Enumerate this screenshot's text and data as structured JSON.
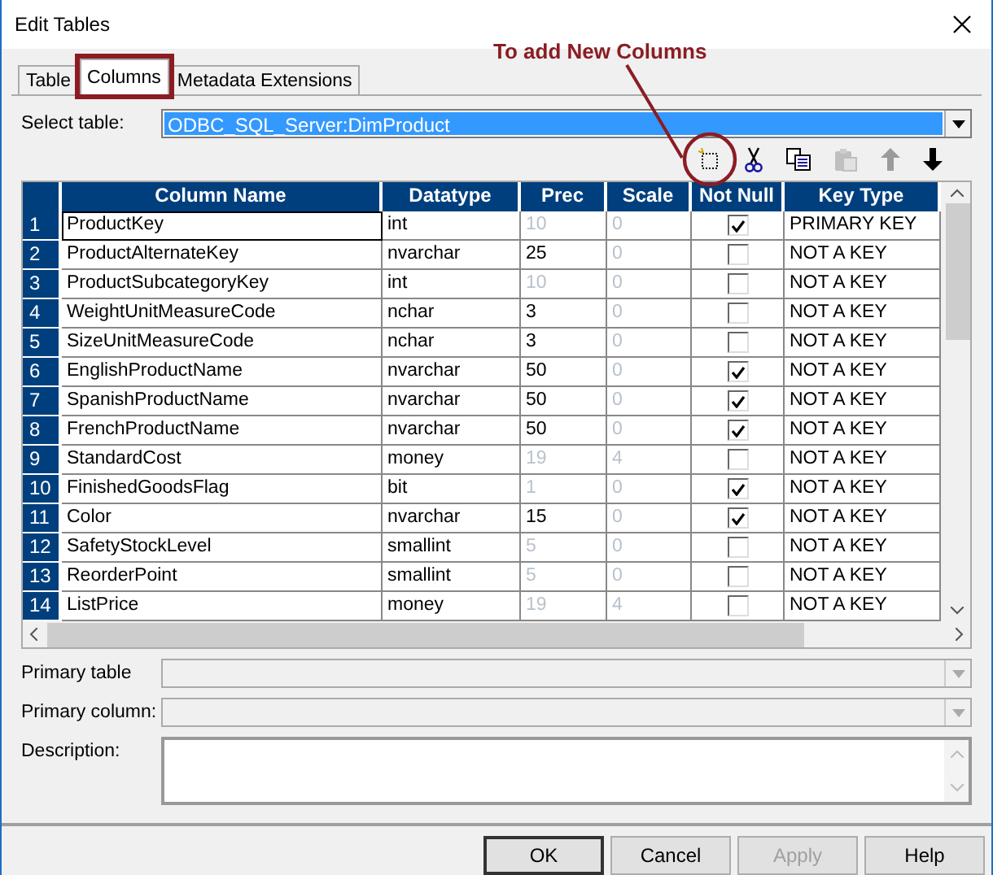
{
  "window": {
    "title": "Edit Tables"
  },
  "tabs": [
    {
      "label": "Table",
      "selected": false,
      "highlighted": false
    },
    {
      "label": "Columns",
      "selected": true,
      "highlighted": true
    },
    {
      "label": "Metadata Extensions",
      "selected": false,
      "highlighted": false
    }
  ],
  "select_table": {
    "label": "Select table:",
    "value": "ODBC_SQL_Server:DimProduct"
  },
  "annotation": {
    "text": "To add New Columns"
  },
  "toolbar": [
    {
      "kind": "new",
      "disabled": false
    },
    {
      "kind": "cut",
      "disabled": false
    },
    {
      "kind": "copy",
      "disabled": false
    },
    {
      "kind": "paste",
      "disabled": true
    },
    {
      "kind": "up",
      "disabled": true
    },
    {
      "kind": "down",
      "disabled": false
    }
  ],
  "table": {
    "columns": [
      "Column Name",
      "Datatype",
      "Prec",
      "Scale",
      "Not Null",
      "Key Type"
    ],
    "rows": [
      {
        "number": "1",
        "name": "ProductKey",
        "datatype": "int",
        "prec": "10",
        "prec_disabled": true,
        "scale": "0",
        "scale_disabled": true,
        "not_null": true,
        "key_type": "PRIMARY KEY",
        "selected": true
      },
      {
        "number": "2",
        "name": "ProductAlternateKey",
        "datatype": "nvarchar",
        "prec": "25",
        "prec_disabled": false,
        "scale": "0",
        "scale_disabled": true,
        "not_null": false,
        "key_type": "NOT A KEY",
        "selected": false
      },
      {
        "number": "3",
        "name": "ProductSubcategoryKey",
        "datatype": "int",
        "prec": "10",
        "prec_disabled": true,
        "scale": "0",
        "scale_disabled": true,
        "not_null": false,
        "key_type": "NOT A KEY",
        "selected": false
      },
      {
        "number": "4",
        "name": "WeightUnitMeasureCode",
        "datatype": "nchar",
        "prec": "3",
        "prec_disabled": false,
        "scale": "0",
        "scale_disabled": true,
        "not_null": false,
        "key_type": "NOT A KEY",
        "selected": false
      },
      {
        "number": "5",
        "name": "SizeUnitMeasureCode",
        "datatype": "nchar",
        "prec": "3",
        "prec_disabled": false,
        "scale": "0",
        "scale_disabled": true,
        "not_null": false,
        "key_type": "NOT A KEY",
        "selected": false
      },
      {
        "number": "6",
        "name": "EnglishProductName",
        "datatype": "nvarchar",
        "prec": "50",
        "prec_disabled": false,
        "scale": "0",
        "scale_disabled": true,
        "not_null": true,
        "key_type": "NOT A KEY",
        "selected": false
      },
      {
        "number": "7",
        "name": "SpanishProductName",
        "datatype": "nvarchar",
        "prec": "50",
        "prec_disabled": false,
        "scale": "0",
        "scale_disabled": true,
        "not_null": true,
        "key_type": "NOT A KEY",
        "selected": false
      },
      {
        "number": "8",
        "name": "FrenchProductName",
        "datatype": "nvarchar",
        "prec": "50",
        "prec_disabled": false,
        "scale": "0",
        "scale_disabled": true,
        "not_null": true,
        "key_type": "NOT A KEY",
        "selected": false
      },
      {
        "number": "9",
        "name": "StandardCost",
        "datatype": "money",
        "prec": "19",
        "prec_disabled": true,
        "scale": "4",
        "scale_disabled": true,
        "not_null": false,
        "key_type": "NOT A KEY",
        "selected": false
      },
      {
        "number": "10",
        "name": "FinishedGoodsFlag",
        "datatype": "bit",
        "prec": "1",
        "prec_disabled": true,
        "scale": "0",
        "scale_disabled": true,
        "not_null": true,
        "key_type": "NOT A KEY",
        "selected": false
      },
      {
        "number": "11",
        "name": "Color",
        "datatype": "nvarchar",
        "prec": "15",
        "prec_disabled": false,
        "scale": "0",
        "scale_disabled": true,
        "not_null": true,
        "key_type": "NOT A KEY",
        "selected": false
      },
      {
        "number": "12",
        "name": "SafetyStockLevel",
        "datatype": "smallint",
        "prec": "5",
        "prec_disabled": true,
        "scale": "0",
        "scale_disabled": true,
        "not_null": false,
        "key_type": "NOT A KEY",
        "selected": false
      },
      {
        "number": "13",
        "name": "ReorderPoint",
        "datatype": "smallint",
        "prec": "5",
        "prec_disabled": true,
        "scale": "0",
        "scale_disabled": true,
        "not_null": false,
        "key_type": "NOT A KEY",
        "selected": false
      },
      {
        "number": "14",
        "name": "ListPrice",
        "datatype": "money",
        "prec": "19",
        "prec_disabled": true,
        "scale": "4",
        "scale_disabled": true,
        "not_null": false,
        "key_type": "NOT A KEY",
        "selected": false
      }
    ]
  },
  "fields": [
    {
      "label": "Primary table",
      "kind": "dropdown"
    },
    {
      "label": "Primary column:",
      "kind": "dropdown"
    },
    {
      "label": "Description:",
      "kind": "textarea"
    }
  ],
  "buttons": [
    {
      "label": "OK",
      "default": true,
      "disabled": false
    },
    {
      "label": "Cancel",
      "default": false,
      "disabled": false
    },
    {
      "label": "Apply",
      "default": false,
      "disabled": true
    },
    {
      "label": "Help",
      "default": false,
      "disabled": false
    }
  ]
}
